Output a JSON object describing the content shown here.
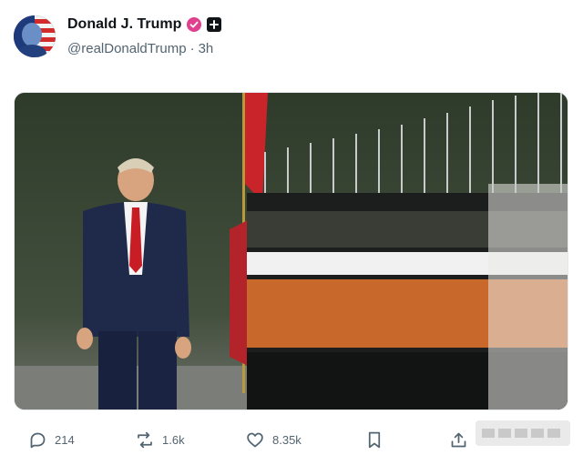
{
  "post": {
    "author": {
      "display_name": "Donald J. Trump",
      "handle": "@realDonaldTrump",
      "separator": "·",
      "time": "3h",
      "verified_icon": "verified-badge-icon",
      "follow_icon": "add-follow-icon"
    },
    "media": {
      "description_icon": "photo"
    },
    "actions": {
      "replies": "214",
      "reposts": "1.6k",
      "likes": "8.35k",
      "reply_icon": "reply-icon",
      "repost_icon": "repost-icon",
      "like_icon": "heart-icon",
      "bookmark_icon": "bookmark-icon",
      "share_icon": "share-icon"
    }
  },
  "colors": {
    "verified": "#e0408d",
    "text_primary": "#0f1419",
    "text_secondary": "#536471"
  }
}
